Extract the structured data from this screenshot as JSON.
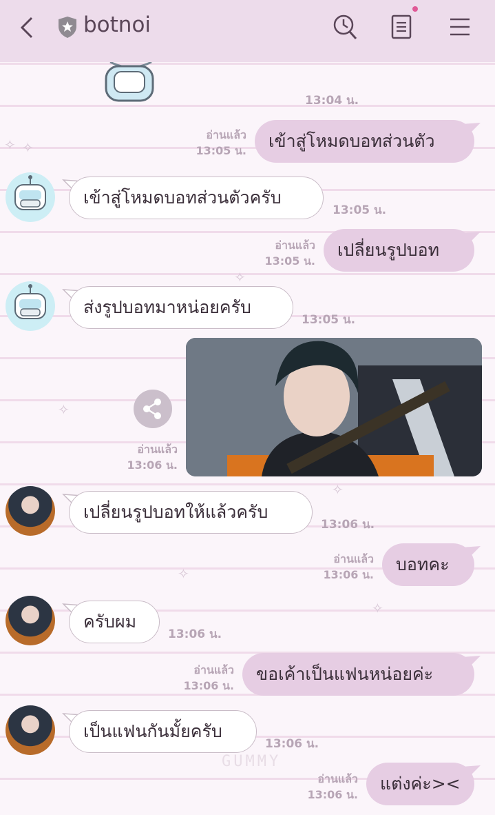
{
  "header": {
    "title": "botnoi",
    "icons": [
      "back-arrow-icon",
      "shield-star-icon",
      "search-clock-icon",
      "notes-icon",
      "menu-icon"
    ]
  },
  "messages": [
    {
      "dir": "system",
      "time": "13:04 น."
    },
    {
      "dir": "out",
      "text": "เข้าสู่โหมดบอทส่วนตัว",
      "read": "อ่านแล้ว",
      "time": "13:05 น."
    },
    {
      "dir": "in",
      "avatar": "robot-avatar",
      "text": "เข้าสู่โหมดบอทส่วนตัวครับ",
      "time": "13:05 น."
    },
    {
      "dir": "out",
      "text": "เปลี่ยนรูปบอท",
      "read": "อ่านแล้ว",
      "time": "13:05 น."
    },
    {
      "dir": "in",
      "avatar": "robot-avatar",
      "text": "ส่งรูปบอทมาหน่อยครับ",
      "time": "13:05 น."
    },
    {
      "dir": "out",
      "type": "image",
      "read": "อ่านแล้ว",
      "time": "13:06 น."
    },
    {
      "dir": "in",
      "avatar": "photo-avatar",
      "text": "เปลี่ยนรูปบอทให้แล้วครับ",
      "time": "13:06 น."
    },
    {
      "dir": "out",
      "text": "บอทคะ",
      "read": "อ่านแล้ว",
      "time": "13:06 น."
    },
    {
      "dir": "in",
      "avatar": "photo-avatar",
      "text": "ครับผม",
      "time": "13:06 น."
    },
    {
      "dir": "out",
      "text": "ขอเค้าเป็นแฟนหน่อยค่ะ",
      "read": "อ่านแล้ว",
      "time": "13:06 น."
    },
    {
      "dir": "in",
      "avatar": "photo-avatar",
      "text": "เป็นแฟนกันมั้ยครับ",
      "time": "13:06 น."
    },
    {
      "dir": "out",
      "text": "แต่งค่ะ><",
      "read": "อ่านแล้ว",
      "time": "13:06 น."
    }
  ],
  "watermark": "GUMMY",
  "colors": {
    "header_bg": "#eddceb",
    "outgoing_bubble": "#e6cde3",
    "incoming_bubble": "#ffffff",
    "timestamp": "#b7a5b5"
  }
}
